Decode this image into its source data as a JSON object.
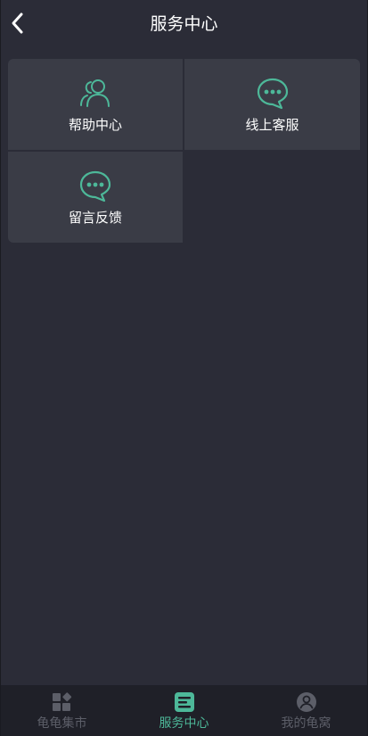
{
  "colors": {
    "background": "#2b2c37",
    "card": "#3a3c46",
    "accent": "#4db899",
    "tab_inactive": "#5c5e68",
    "tabbar": "#1f2028"
  },
  "header": {
    "title": "服务中心",
    "back_icon": "chevron-left-icon"
  },
  "services": [
    {
      "label": "帮助中心",
      "icon": "users-icon"
    },
    {
      "label": "线上客服",
      "icon": "chat-bubble-icon"
    },
    {
      "label": "留言反馈",
      "icon": "chat-bubble-icon"
    }
  ],
  "tabbar": {
    "tabs": [
      {
        "label": "龟龟集市",
        "icon": "apps-icon",
        "active": false
      },
      {
        "label": "服务中心",
        "icon": "service-card-icon",
        "active": true
      },
      {
        "label": "我的龟窝",
        "icon": "user-circle-icon",
        "active": false
      }
    ]
  }
}
